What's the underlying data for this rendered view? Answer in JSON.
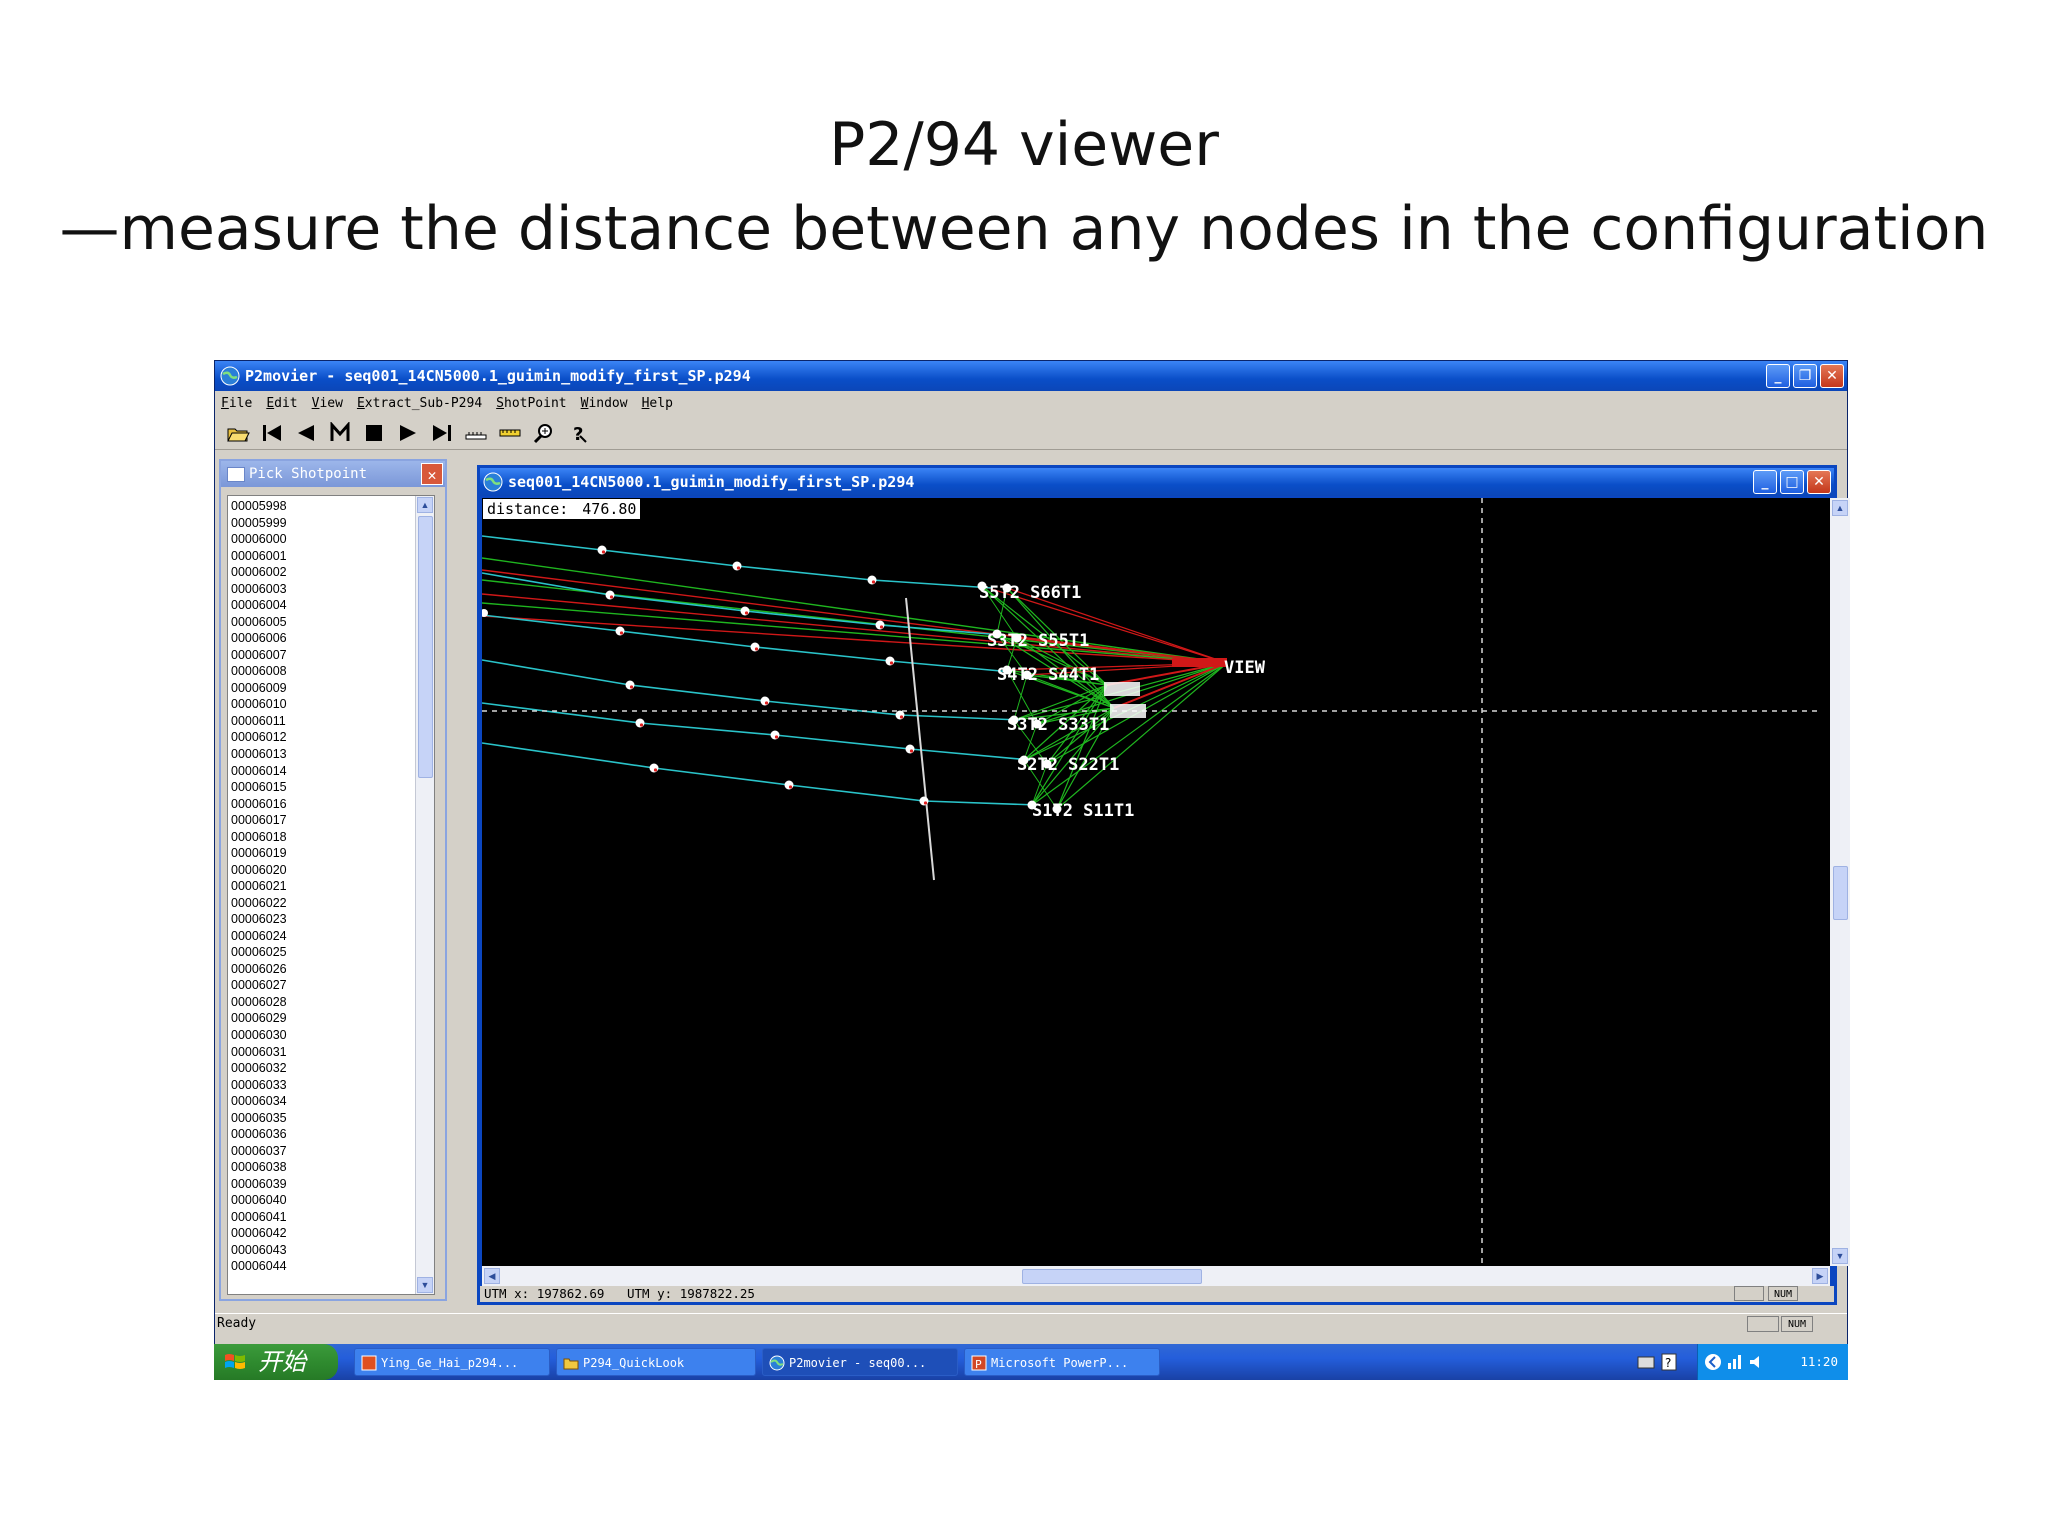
{
  "slide": {
    "title_line1": "P2/94 viewer",
    "title_line2": "—measure the distance between any nodes in the configuration"
  },
  "app": {
    "title": "P2movier - seq001_14CN5000.1_guimin_modify_first_SP.p294",
    "menu": [
      "File",
      "Edit",
      "View",
      "Extract_Sub-P294",
      "ShotPoint",
      "Window",
      "Help"
    ],
    "toolbar_icons": [
      "open-icon",
      "first-icon",
      "prev-icon",
      "mark-icon",
      "stop-icon",
      "play-icon",
      "last-icon",
      "ruler-icon",
      "measure-icon",
      "zoom-icon",
      "help-icon"
    ],
    "status": "Ready",
    "status_num": "NUM"
  },
  "pick_panel": {
    "title": "Pick Shotpoint",
    "items": [
      "00005998",
      "00005999",
      "00006000",
      "00006001",
      "00006002",
      "00006003",
      "00006004",
      "00006005",
      "00006006",
      "00006007",
      "00006008",
      "00006009",
      "00006010",
      "00006011",
      "00006012",
      "00006013",
      "00006014",
      "00006015",
      "00006016",
      "00006017",
      "00006018",
      "00006019",
      "00006020",
      "00006021",
      "00006022",
      "00006023",
      "00006024",
      "00006025",
      "00006026",
      "00006027",
      "00006028",
      "00006029",
      "00006030",
      "00006031",
      "00006032",
      "00006033",
      "00006034",
      "00006035",
      "00006036",
      "00006037",
      "00006038",
      "00006039",
      "00006040",
      "00006041",
      "00006042",
      "00006043",
      "00006044"
    ]
  },
  "viewer": {
    "title": "seq001_14CN5000.1_guimin_modify_first_SP.p294",
    "distance_label": "distance:",
    "distance_value": "476.80",
    "utm_x_label": "UTM x:",
    "utm_x": "197862.69",
    "utm_y_label": "UTM y:",
    "utm_y": "1987822.25",
    "status_num": "NUM",
    "node_labels": {
      "s6": "S5T2 S66T1",
      "s5": "S3T2 S55T1",
      "s4": "S4T2 S44T1",
      "s3": "S3T2 S33T1",
      "s2": "S2T2 S22T1",
      "s1": "S1T2 S11T1",
      "vessel": "VIEW"
    },
    "colors": {
      "streamer": "#2ac3c9",
      "green_link": "#1fb51f",
      "red_link": "#d01818",
      "background": "#000000"
    }
  },
  "taskbar": {
    "start_label": "开始",
    "tasks": [
      {
        "label": "Ying_Ge_Hai_p294..."
      },
      {
        "label": "P294_QuickLook"
      },
      {
        "label": "P2movier - seq00..."
      },
      {
        "label": "Microsoft PowerP..."
      }
    ],
    "clock": "11:20"
  }
}
